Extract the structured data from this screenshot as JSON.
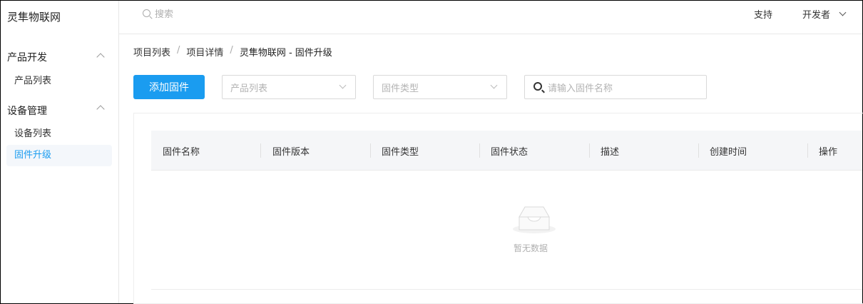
{
  "sidebar": {
    "brand": "灵隼物联网",
    "groups": [
      {
        "title": "产品开发",
        "items": [
          {
            "label": "产品列表"
          }
        ]
      },
      {
        "title": "设备管理",
        "items": [
          {
            "label": "设备列表"
          },
          {
            "label": "固件升级"
          }
        ]
      }
    ]
  },
  "header": {
    "search_placeholder": "搜索",
    "support": "支持",
    "developer": "开发者"
  },
  "breadcrumb": [
    "项目列表",
    "项目详情",
    "灵隼物联网 - 固件升级"
  ],
  "breadcrumb_sep": "/",
  "toolbar": {
    "add_label": "添加固件",
    "product_placeholder": "产品列表",
    "type_placeholder": "固件类型",
    "name_placeholder": "请输入固件名称"
  },
  "table": {
    "columns": [
      "固件名称",
      "固件版本",
      "固件类型",
      "固件状态",
      "描述",
      "创建时间",
      "操作"
    ],
    "empty_text": "暂无数据"
  },
  "colors": {
    "accent": "#1a9cf0"
  }
}
